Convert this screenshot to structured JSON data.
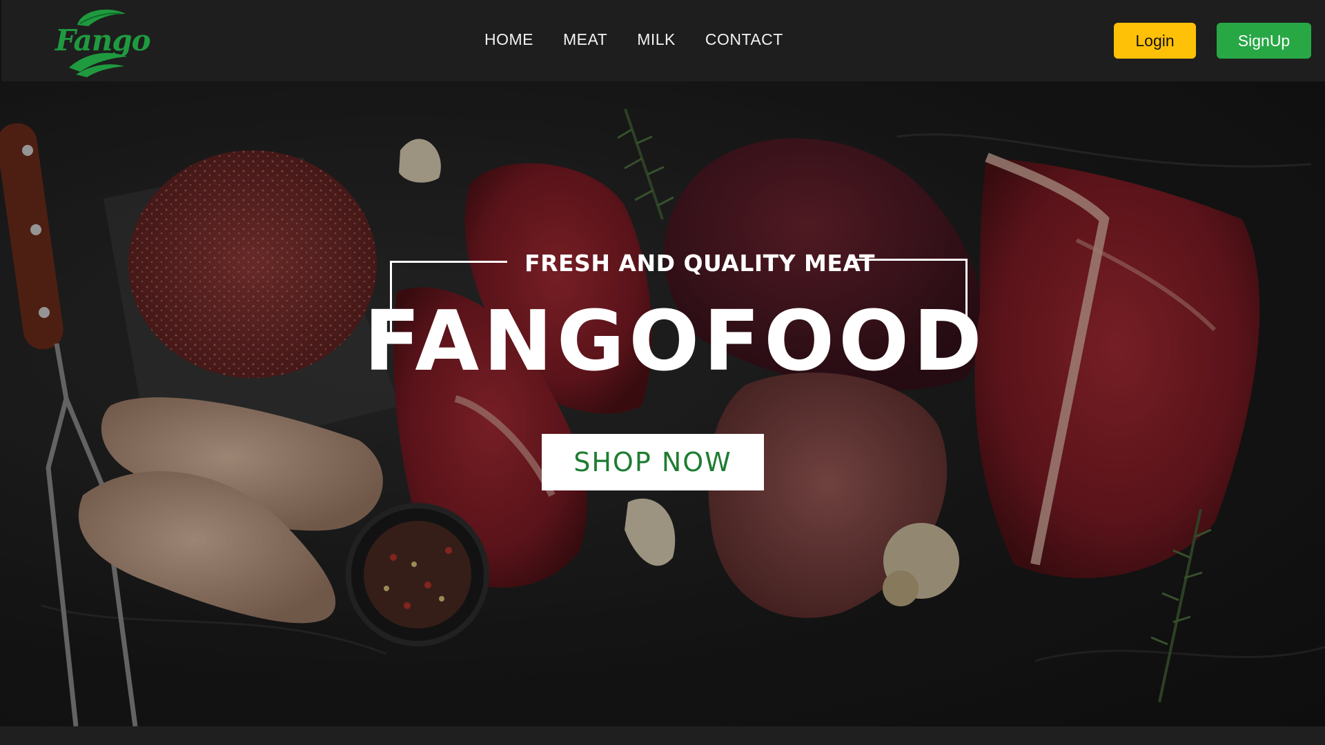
{
  "brand": {
    "logo_text": "Fango",
    "logo_color": "#1f9a3f"
  },
  "nav": {
    "links": [
      "HOME",
      "MEAT",
      "MILK",
      "CONTACT"
    ]
  },
  "auth": {
    "login_label": "Login",
    "signup_label": "SignUp",
    "login_color": "#ffc107",
    "signup_color": "#28a745"
  },
  "hero": {
    "subtitle": "FRESH AND QUALITY MEAT",
    "title": "FANGOFOOD",
    "cta_label": "SHOP NOW",
    "cta_text_color": "#1e7d32"
  }
}
